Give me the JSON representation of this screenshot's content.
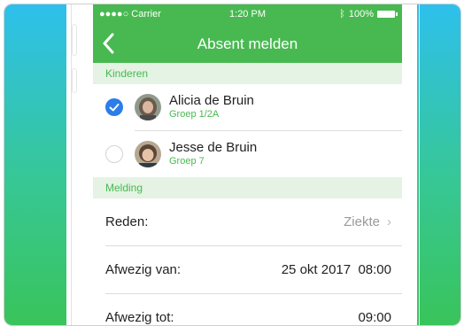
{
  "status_bar": {
    "carrier": "●●●●○ Carrier",
    "time": "1:20 PM",
    "battery": "100%"
  },
  "nav": {
    "title": "Absent melden"
  },
  "sections": {
    "children": "Kinderen",
    "report": "Melding"
  },
  "children": [
    {
      "name": "Alicia de Bruin",
      "group": "Groep 1/2A",
      "selected": true
    },
    {
      "name": "Jesse de Bruin",
      "group": "Groep 7",
      "selected": false
    }
  ],
  "form": {
    "reason": {
      "label": "Reden:",
      "value": "Ziekte"
    },
    "absent_from": {
      "label": "Afwezig van:",
      "value": "25 okt 2017  08:00"
    },
    "absent_until": {
      "label": "Afwezig tot:",
      "value": "09:00"
    }
  },
  "colors": {
    "accent": "#48b951",
    "check": "#2b7de9",
    "section_bg": "#e4f3e3"
  }
}
